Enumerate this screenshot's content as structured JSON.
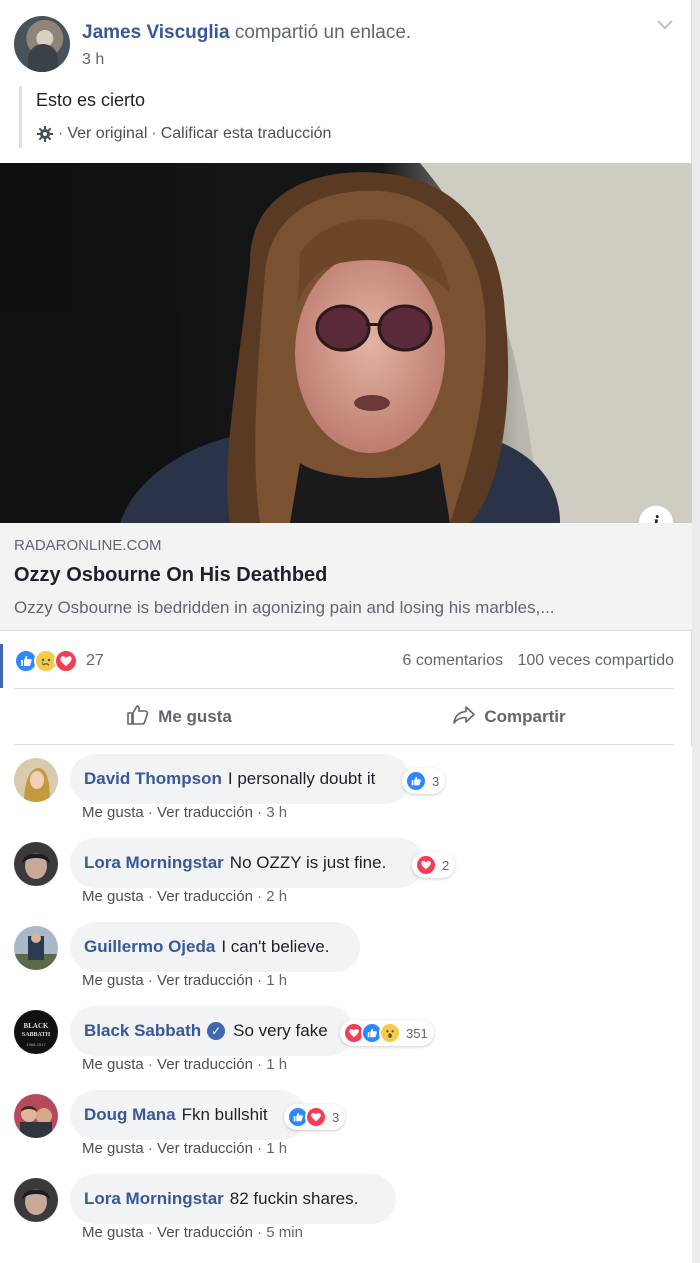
{
  "post": {
    "author": "James Viscuglia",
    "action": "compartió un enlace.",
    "time": "3 h",
    "text": "Esto es cierto",
    "translation_links": {
      "see_original": "Ver original",
      "rate_translation": "Calificar esta traducción"
    }
  },
  "link_preview": {
    "domain": "RADARONLINE.COM",
    "title": "Ozzy Osbourne On His Deathbed",
    "description": "Ozzy Osbourne is bedridden in agonizing pain and losing his marbles,..."
  },
  "reactions": {
    "types": [
      "like-icon",
      "sad-icon",
      "love-icon"
    ],
    "count": "27",
    "comments": "6 comentarios",
    "shares": "100 veces compartido"
  },
  "actions": {
    "like": "Me gusta",
    "share": "Compartir"
  },
  "comments": [
    {
      "name": "David Thompson",
      "text": "I personally doubt it",
      "reactions": [
        "like-icon"
      ],
      "reaction_count": "3",
      "like": "Me gusta",
      "translate": "Ver traducción",
      "time": "3 h",
      "verified": false
    },
    {
      "name": "Lora Morningstar",
      "text": "No OZZY is just fine.",
      "reactions": [
        "love-icon"
      ],
      "reaction_count": "2",
      "like": "Me gusta",
      "translate": "Ver traducción",
      "time": "2 h",
      "verified": false
    },
    {
      "name": "Guillermo Ojeda",
      "text": "I can't believe.",
      "reactions": [],
      "reaction_count": "",
      "like": "Me gusta",
      "translate": "Ver traducción",
      "time": "1 h",
      "verified": false
    },
    {
      "name": "Black Sabbath",
      "text": "So very fake",
      "reactions": [
        "love-icon",
        "like-icon",
        "wow-icon"
      ],
      "reaction_count": "351",
      "like": "Me gusta",
      "translate": "Ver traducción",
      "time": "1 h",
      "verified": true
    },
    {
      "name": "Doug Mana",
      "text": "Fkn bullshit",
      "reactions": [
        "like-icon",
        "love-icon"
      ],
      "reaction_count": "3",
      "like": "Me gusta",
      "translate": "Ver traducción",
      "time": "1 h",
      "verified": false
    },
    {
      "name": "Lora Morningstar",
      "text": "82 fuckin shares.",
      "reactions": [],
      "reaction_count": "",
      "like": "Me gusta",
      "translate": "Ver traducción",
      "time": "5 min",
      "verified": false
    }
  ],
  "colors": {
    "link": "#385898",
    "meta": "#616770",
    "like": "#2d88ff",
    "love": "#f33e58",
    "haha_wow": "#f7c948"
  },
  "avatar_badge": {
    "black_sabbath_logo": "BLACK SABBATH",
    "black_sabbath_years": "1968-2017"
  }
}
